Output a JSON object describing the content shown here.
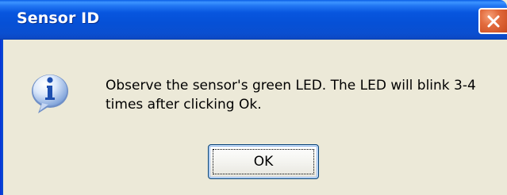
{
  "window": {
    "title": "Sensor ID",
    "close_icon": "close-icon"
  },
  "dialog": {
    "icon": "info-icon",
    "message_line1": "Observe the sensor's green LED. The LED will blink 3-4",
    "message_line2": "times after clicking Ok.",
    "ok_label": "OK"
  },
  "colors": {
    "titlebar": "#0756df",
    "body_background": "#ece9d8",
    "close_button": "#e26b3d",
    "button_border": "#003c74"
  }
}
